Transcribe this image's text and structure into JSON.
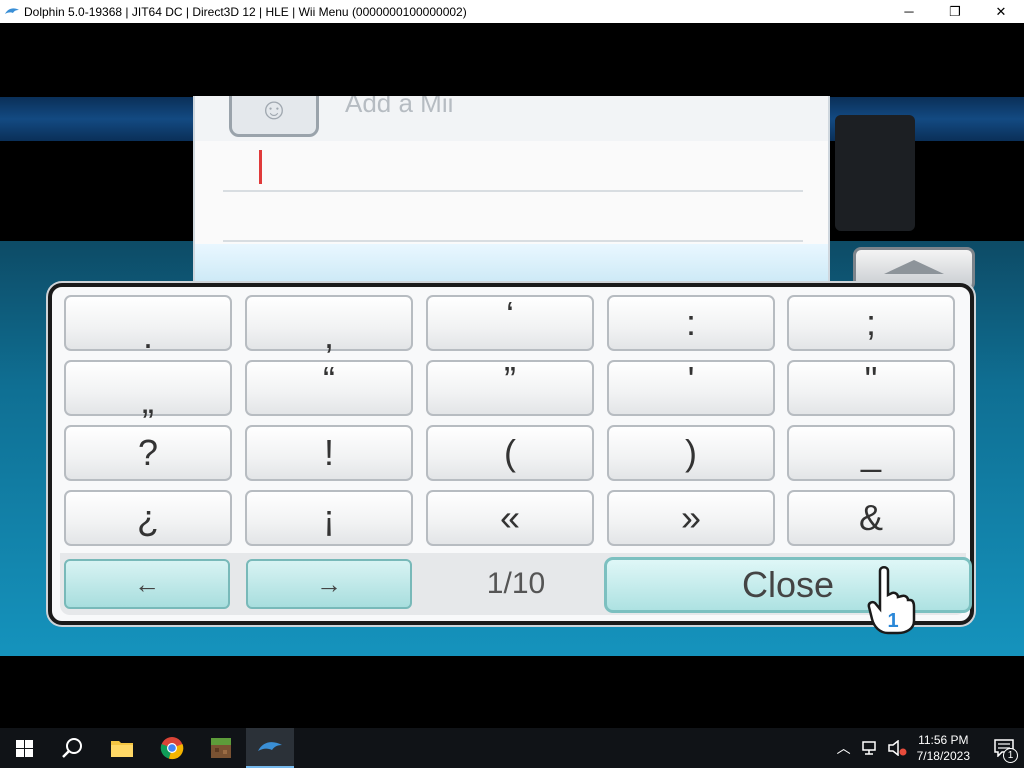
{
  "window": {
    "title": "Dolphin 5.0-19368 | JIT64 DC | Direct3D 12 | HLE | Wii Menu (0000000100000002)",
    "minimize": "─",
    "maximize": "❐",
    "close": "✕"
  },
  "mii_panel": {
    "title": "Add a Mii"
  },
  "keyboard": {
    "keys": [
      [
        ".",
        ",",
        "‘",
        ":",
        ";"
      ],
      [
        "„",
        "“",
        "”",
        "'",
        "\""
      ],
      [
        "?",
        "!",
        "(",
        ")",
        "_"
      ],
      [
        "¿",
        "¡",
        "«",
        "»",
        "&"
      ]
    ],
    "prev_label": "←",
    "next_label": "→",
    "page_indicator": "1/10",
    "close_label": "Close"
  },
  "pointer": {
    "player_number": "1"
  },
  "taskbar": {
    "clock_time": "11:56 PM",
    "clock_date": "7/18/2023",
    "notification_count": "1"
  }
}
